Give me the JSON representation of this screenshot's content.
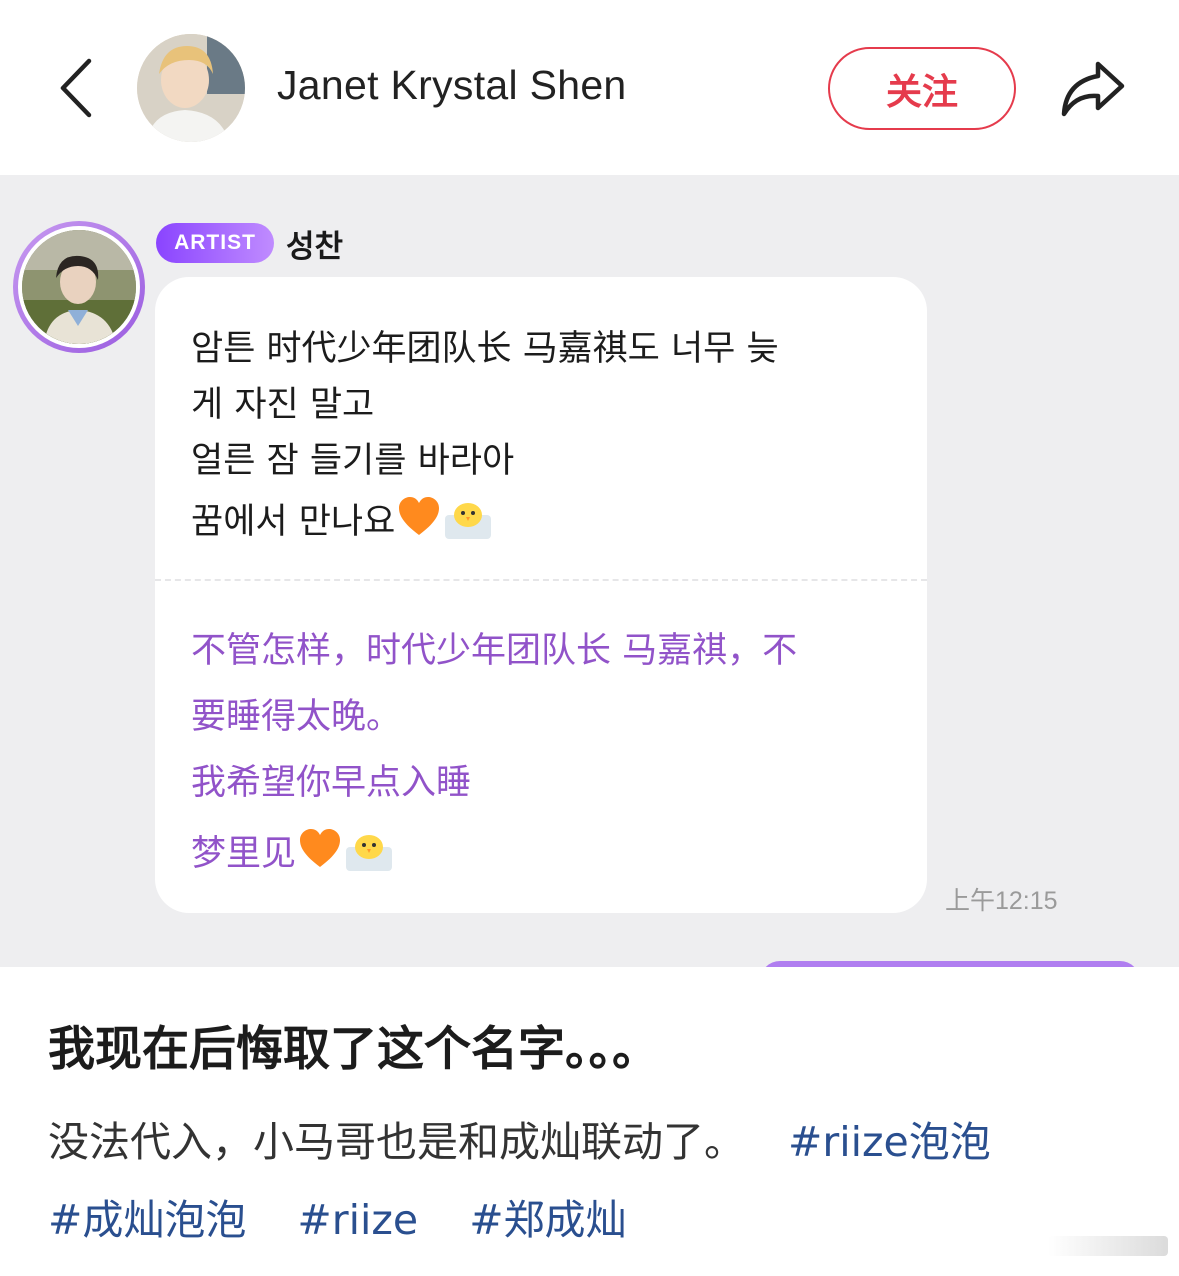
{
  "header": {
    "back_icon": "chevron-left-icon",
    "author_name": "Janet Krystal Shen",
    "follow_label": "关注",
    "share_icon": "share-arrow-icon",
    "accent_color": "#e53b4c"
  },
  "chat": {
    "badge": "ARTIST",
    "sender": "성찬",
    "message_lines": [
      "암튼 时代少年团队长 马嘉祺도 너무 늦",
      "게 자진 말고",
      "얼른 잠 들기를 바라아",
      "꿈에서 만나요"
    ],
    "translation_lines": [
      "不管怎样，时代少年团队长 马嘉祺，不",
      "要睡得太晚。",
      "我希望你早点入睡",
      "梦里见"
    ],
    "emojis": [
      "orange-heart-icon",
      "chick-icon"
    ],
    "time": "上午12:15",
    "translation_color": "#9153c9"
  },
  "post": {
    "title": "我现在后悔取了这个名字。。。",
    "body_text": "没法代入，小马哥也是和成灿联动了。",
    "hashtags": [
      "#riize泡泡",
      "#成灿泡泡",
      "#riize",
      "#郑成灿"
    ],
    "hashtag_color": "#2a4f8f"
  }
}
